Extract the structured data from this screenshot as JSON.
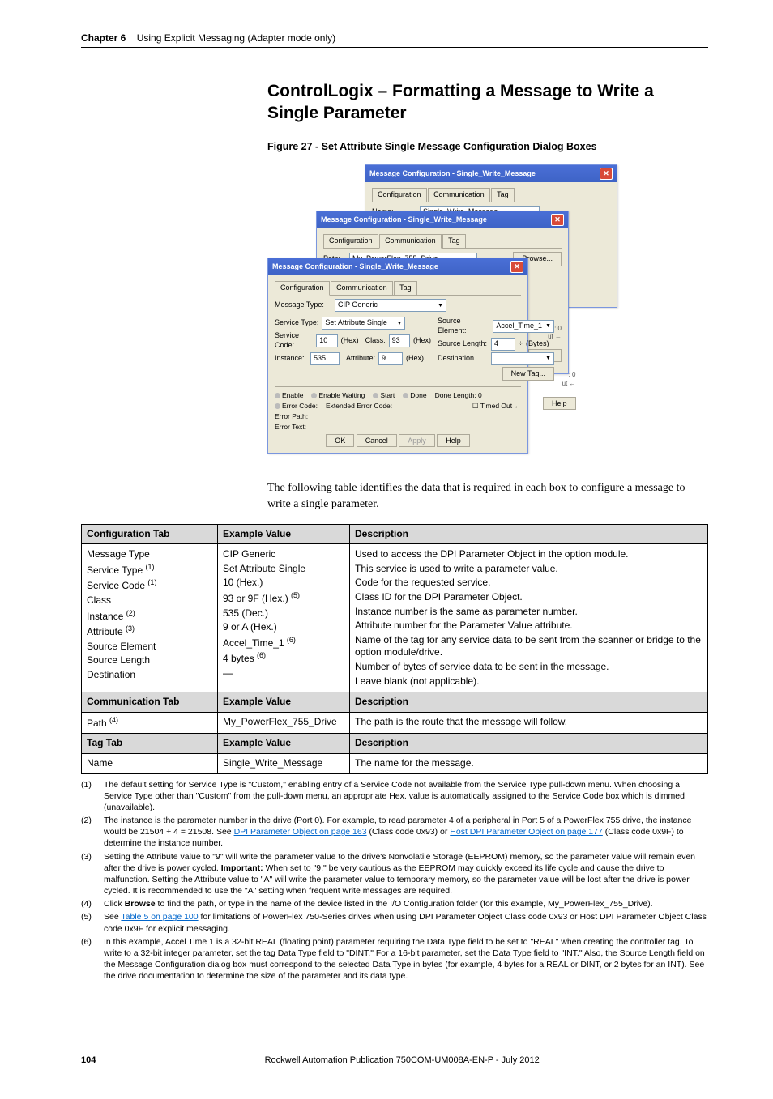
{
  "header": {
    "chapter": "Chapter 6",
    "title": "Using Explicit Messaging (Adapter mode only)"
  },
  "section_title": "ControlLogix – Formatting a Message to Write a Single Parameter",
  "figure_caption": "Figure 27 - Set Attribute Single Message Configuration Dialog Boxes",
  "body_text": "The following table identifies the data that is required in each box to configure a message to write a single parameter.",
  "dialogs": {
    "window_title": "Message Configuration - Single_Write_Message",
    "tabs": {
      "config": "Configuration",
      "comm": "Communication",
      "tag": "Tag"
    },
    "tag_tab": {
      "name_label": "Name:",
      "name_value": "Single_Write_Message"
    },
    "comm_tab": {
      "path_label": "Path:",
      "path_value": "My_PowerFlex_755_Drive",
      "browse": "Browse..."
    },
    "config_tab": {
      "msg_type_label": "Message Type:",
      "msg_type_value": "CIP Generic",
      "svc_type_label": "Service Type:",
      "svc_type_value": "Set Attribute Single",
      "svc_code_label": "Service Code:",
      "svc_code_value": "10",
      "hex": "(Hex)",
      "class_label": "Class:",
      "class_value": "93",
      "instance_label": "Instance:",
      "instance_value": "535",
      "attribute_label": "Attribute:",
      "attribute_value": "9",
      "src_elem_label": "Source Element:",
      "src_elem_value": "Accel_Time_1",
      "src_len_label": "Source Length:",
      "src_len_value": "4",
      "bytes": "(Bytes)",
      "dest_label": "Destination",
      "new_tag": "New Tag..."
    },
    "status": {
      "enable": "Enable",
      "enable_waiting": "Enable Waiting",
      "start": "Start",
      "done": "Done",
      "done_len": "Done Length: 0",
      "err_code": "Error Code:",
      "ext_err": "Extended Error Code:",
      "timed_out": "Timed Out",
      "err_path": "Error Path:",
      "err_text": "Error Text:"
    },
    "buttons": {
      "ok": "OK",
      "cancel": "Cancel",
      "apply": "Apply",
      "help": "Help"
    }
  },
  "table": {
    "headers": {
      "config_tab": "Configuration Tab",
      "comm_tab": "Communication Tab",
      "tag_tab": "Tag Tab",
      "example": "Example Value",
      "desc": "Description"
    },
    "config_rows": [
      {
        "p": "Message Type",
        "sup": "",
        "v": "CIP Generic",
        "d": "Used to access the DPI Parameter Object in the option module."
      },
      {
        "p": "Service Type",
        "sup": "(1)",
        "v": "Set Attribute Single",
        "d": "This service is used to write a parameter value."
      },
      {
        "p": "Service Code",
        "sup": "(1)",
        "v": "10 (Hex.)",
        "d": "Code for the requested service."
      },
      {
        "p": "Class",
        "sup": "",
        "v": "93 or 9F (Hex.)",
        "vsup": "(5)",
        "d": "Class ID for the DPI Parameter Object."
      },
      {
        "p": "Instance",
        "sup": "(2)",
        "v": "535 (Dec.)",
        "d": "Instance number is the same as parameter number."
      },
      {
        "p": "Attribute",
        "sup": "(3)",
        "v": "9 or A (Hex.)",
        "d": "Attribute number for the Parameter Value attribute."
      },
      {
        "p": "Source Element",
        "sup": "",
        "v": "Accel_Time_1",
        "vsup": "(6)",
        "d": "Name of the tag for any service data to be sent from the scanner or bridge to the option module/drive."
      },
      {
        "p": "Source Length",
        "sup": "",
        "v": "4 bytes",
        "vsup": "(6)",
        "d": "Number of bytes of service data to be sent in the message."
      },
      {
        "p": "Destination",
        "sup": "",
        "v": "—",
        "d": "Leave blank (not applicable)."
      }
    ],
    "comm_row": {
      "p": "Path",
      "sup": "(4)",
      "v": "My_PowerFlex_755_Drive",
      "d": "The path is the route that the message will follow."
    },
    "tag_row": {
      "p": "Name",
      "v": "Single_Write_Message",
      "d": "The name for the message."
    }
  },
  "footnotes": {
    "f1": "The default setting for Service Type is \"Custom,\" enabling entry of a Service Code not available from the Service Type pull-down menu. When choosing a Service Type other than \"Custom\" from the pull-down menu, an appropriate Hex. value is automatically assigned to the Service Code box which is dimmed (unavailable).",
    "f2_a": "The instance is the parameter number in the drive (Port 0). For example, to read parameter 4 of a peripheral in Port 5 of a PowerFlex 755 drive, the instance would be 21504 + 4 = 21508. See ",
    "f2_link1": "DPI Parameter Object on page 163",
    "f2_b": " (Class code 0x93) or ",
    "f2_link2": "Host DPI Parameter Object on page 177",
    "f2_c": " (Class code 0x9F) to determine the instance number.",
    "f3_a": "Setting the Attribute value to \"9\" will write the parameter value to the drive's Nonvolatile Storage (EEPROM) memory, so the parameter value will remain even after the drive is power cycled. ",
    "f3_imp": "Important:",
    "f3_b": " When set to \"9,\" be very cautious as the EEPROM may quickly exceed its life cycle and cause the drive to malfunction. Setting the Attribute value to \"A\" will write the parameter value to temporary memory, so the parameter value will be lost after the drive is power cycled. It is recommended to use the \"A\" setting when frequent write messages are required.",
    "f4_a": "Click ",
    "f4_b": "Browse",
    "f4_c": " to find the path, or type in the name of the device listed in the I/O Configuration folder (for this example, My_PowerFlex_755_Drive).",
    "f5_a": "See ",
    "f5_link": "Table 5 on page 100",
    "f5_b": " for limitations of PowerFlex 750-Series drives when using DPI Parameter Object Class code 0x93 or Host DPI Parameter Object Class code 0x9F for explicit messaging.",
    "f6": "In this example, Accel Time 1 is a 32-bit REAL (floating point) parameter requiring the Data Type field to be set to \"REAL\" when creating the controller tag. To write to a 32-bit integer parameter, set the tag Data Type field to \"DINT.\" For a 16-bit parameter, set the Data Type field to \"INT.\" Also, the Source Length field on the Message Configuration dialog box must correspond to the selected Data Type in bytes (for example, 4 bytes for a REAL or DINT, or 2 bytes for an INT). See the drive documentation to determine the size of the parameter and its data type."
  },
  "footer": {
    "page": "104",
    "pub": "Rockwell Automation Publication 750COM-UM008A-EN-P - July 2012"
  }
}
